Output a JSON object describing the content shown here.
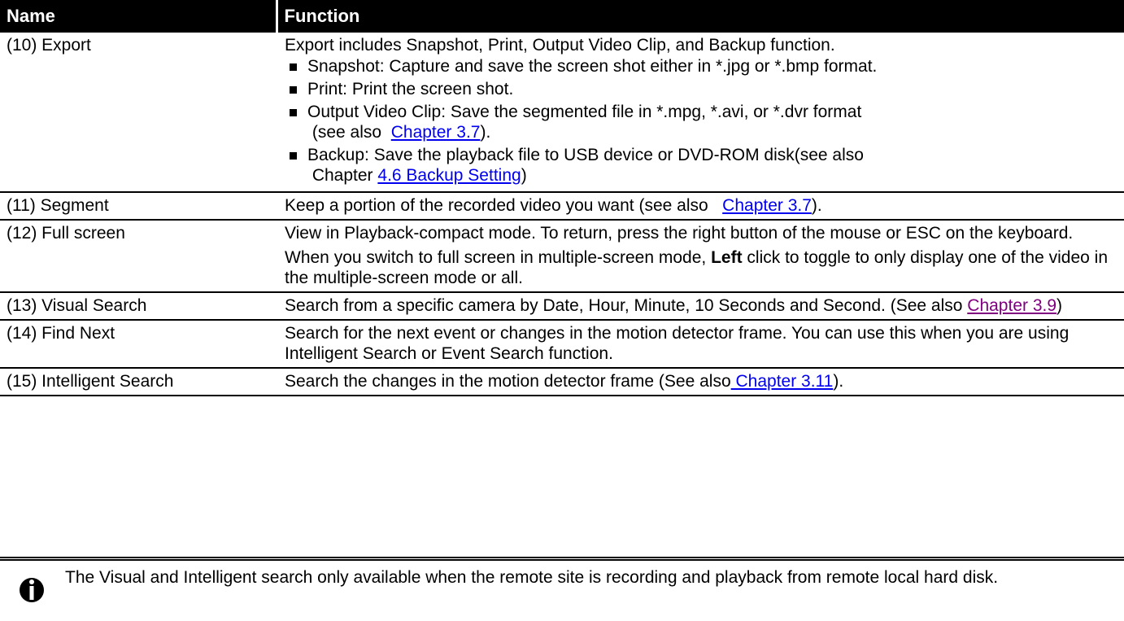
{
  "table": {
    "headers": {
      "name": "Name",
      "function": "Function"
    },
    "export": {
      "name": "(10) Export",
      "intro": "Export includes Snapshot, Print, Output Video Clip, and Backup function.",
      "b1": "Snapshot: Capture and save the screen shot either in *.jpg or *.bmp format.",
      "b2": "Print: Print the screen shot.",
      "b3_main": "Output Video Clip: Save the segmented file in *.mpg, *.avi, or *.dvr format",
      "b3_pre": " (see also  ",
      "b3_link": "Chapter 3.7",
      "b3_post": ").",
      "b4_main": "Backup: Save the playback file to USB device or DVD-ROM disk(see also",
      "b4_pre": " Chapter ",
      "b4_link": "4.6 Backup Setting",
      "b4_post": ")"
    },
    "segment": {
      "name": "(11) Segment",
      "text": "Keep a portion of the recorded video you want (see also   ",
      "link": "Chapter 3.7",
      "post": ")."
    },
    "fullscreen": {
      "name": "(12) Full screen",
      "p1": "View in Playback-compact mode. To return, press the right button of the mouse or ESC on the keyboard.",
      "p2_pre": "When you switch to full screen in multiple-screen mode, ",
      "p2_bold": "Left",
      "p2_post": " click to toggle to only display one of the video in the multiple-screen mode or all."
    },
    "visual": {
      "name": "(13) Visual Search",
      "text": "Search from a specific camera by Date, Hour, Minute, 10 Seconds and Second. (See also ",
      "link": "Chapter 3.9",
      "post": ")"
    },
    "findnext": {
      "name": "(14) Find Next",
      "text": "Search for the next event or changes in the motion detector frame. You can use this when you are using Intelligent Search or Event Search function."
    },
    "intelligent": {
      "name": "(15) Intelligent Search",
      "text": "Search the changes in the motion detector frame (See also",
      "link": " Chapter 3.11",
      "post": ")."
    }
  },
  "note": {
    "icon": "info-icon",
    "text": "The Visual and Intelligent search only available when the remote site is recording and playback from remote local hard disk."
  }
}
